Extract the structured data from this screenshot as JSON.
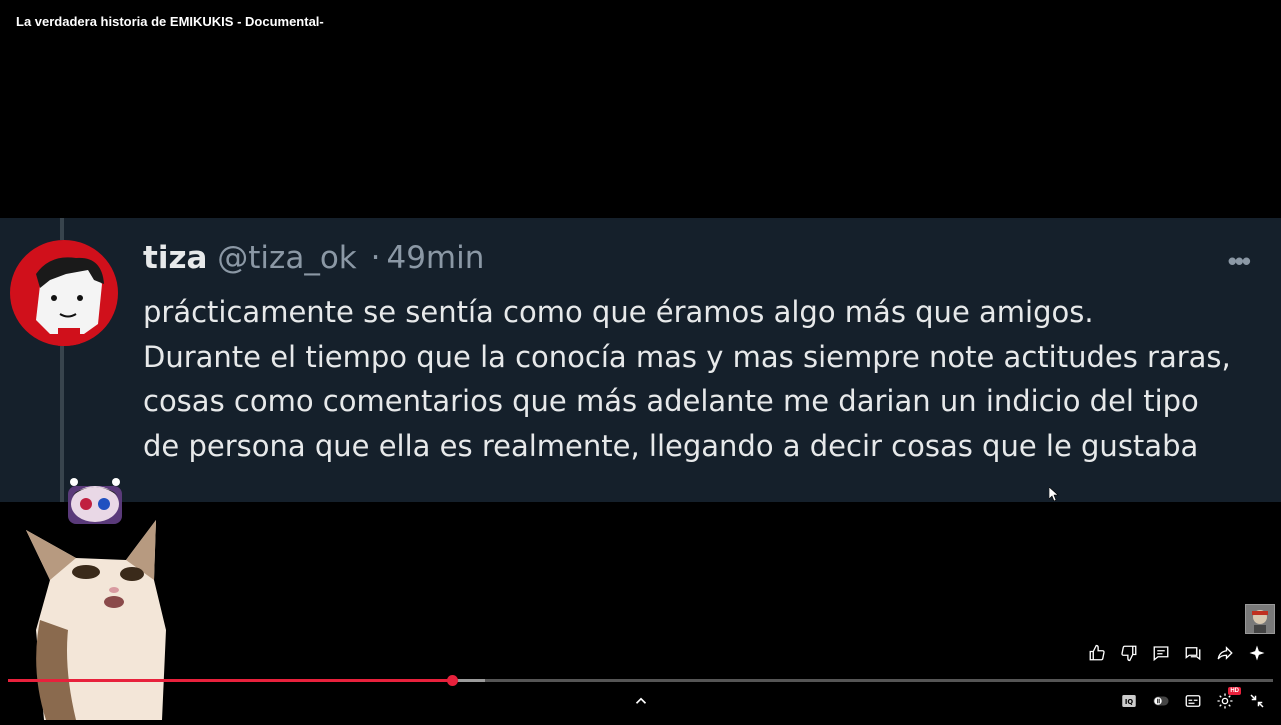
{
  "video": {
    "title": "La verdadera historia de EMIKUKIS - Documental-"
  },
  "tweet": {
    "display_name": "tiza",
    "handle": "@tiza_ok",
    "separator": "·",
    "time": "49min",
    "more_label": "•••",
    "lines": [
      "prácticamente se sentía como que éramos algo más que amigos.",
      "Durante el tiempo que la conocía mas y mas siempre note actitudes raras,",
      "cosas como comentarios que más adelante me darian un indicio del tipo",
      "de persona que ella es realmente, llegando a decir cosas que le gustaba"
    ]
  },
  "player": {
    "progress_fraction": 0.351,
    "buffer_fraction": 0.377,
    "accent_color": "#e8213c",
    "hd_badge": "HD"
  },
  "actions": [
    "thumbs-up-icon",
    "thumbs-down-icon",
    "comment-icon",
    "chat-icon",
    "share-icon",
    "sparkle-icon"
  ],
  "controls": [
    "iq-icon",
    "toggle-icon",
    "captions-icon",
    "settings-icon",
    "exit-fullscreen-icon"
  ]
}
